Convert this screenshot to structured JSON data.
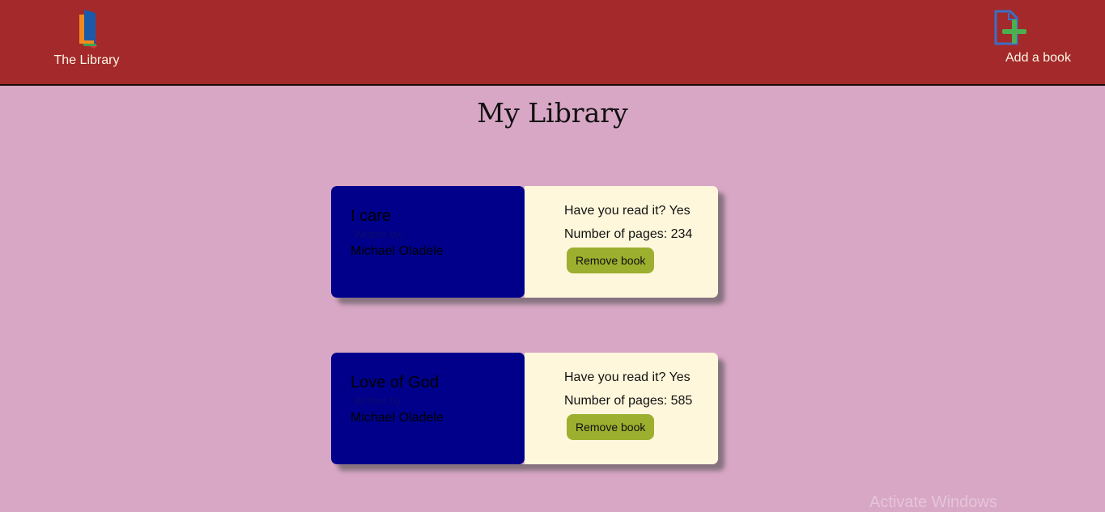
{
  "header": {
    "brand_label": "The Library",
    "add_label": "Add a book"
  },
  "main": {
    "title": "My Library"
  },
  "books": [
    {
      "title": "I care",
      "written_by": "Written by:",
      "author": "Michael Oladele",
      "read_text": "Have you read it? Yes",
      "pages_text": "Number of pages: 234",
      "remove_label": "Remove book"
    },
    {
      "title": "Love of God",
      "written_by": "Written by:",
      "author": "Michael Oladele",
      "read_text": "Have you read it? Yes",
      "pages_text": "Number of pages: 585",
      "remove_label": "Remove book"
    }
  ],
  "watermark": "Activate Windows",
  "colors": {
    "header_bg": "#a3292a",
    "page_bg": "#d8a7c5",
    "card_left": "#00008b",
    "card_right": "#fff7dc",
    "button": "#9caf2e"
  },
  "icons": [
    "library-logo-icon",
    "add-book-icon"
  ]
}
